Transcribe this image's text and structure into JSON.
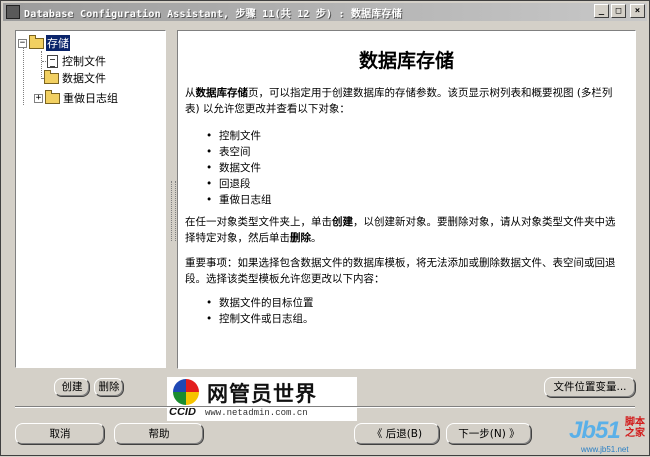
{
  "window": {
    "title": "Database Configuration Assistant, 步骤 11(共 12 步) : 数据库存储",
    "controls": {
      "minimize": "_",
      "maximize": "□",
      "close": "×"
    }
  },
  "tree": {
    "root": {
      "label": "存储",
      "expander": "−"
    },
    "items": [
      {
        "label": "控制文件"
      },
      {
        "label": "数据文件"
      },
      {
        "label": "重做日志组",
        "expander": "+"
      }
    ]
  },
  "content": {
    "heading": "数据库存储",
    "intro_pre": "从",
    "intro_bold": "数据库存储",
    "intro_post": "页，可以指定用于创建数据库的存储参数。该页显示树列表和概要视图 (多栏列表) 以允许您更改并查看以下对象：",
    "objects": [
      "控制文件",
      "表空间",
      "数据文件",
      "回退段",
      "重做日志组"
    ],
    "create_pre": "在任一对象类型文件夹上，单击",
    "create_bold": "创建",
    "create_mid": "，以创建新对象。要删除对象，请从对象类型文件夹中选择特定对象，然后单击",
    "delete_bold": "删除",
    "create_end": "。",
    "note": "重要事项：如果选择包含数据文件的数据库模板，将无法添加或删除数据文件、表空间或回退段。选择该类型模板允许您更改以下内容：",
    "changes": [
      "数据文件的目标位置",
      "控制文件或日志组。"
    ]
  },
  "buttons": {
    "create": "创建",
    "delete": "删除",
    "file_location_vars": "文件位置变量...",
    "cancel": "取消",
    "help": "帮助",
    "back": "《  后退(B)",
    "next": "下一步(N)  》"
  },
  "watermark": {
    "logo_cn": "网管员世界",
    "logo_ccid": "CCID",
    "logo_url": "www.netadmin.com.cn",
    "jb51_big": "Jb51",
    "jb51_side1": "脚本",
    "jb51_side2": "之家",
    "jb51_url": "www.jb51.net"
  }
}
